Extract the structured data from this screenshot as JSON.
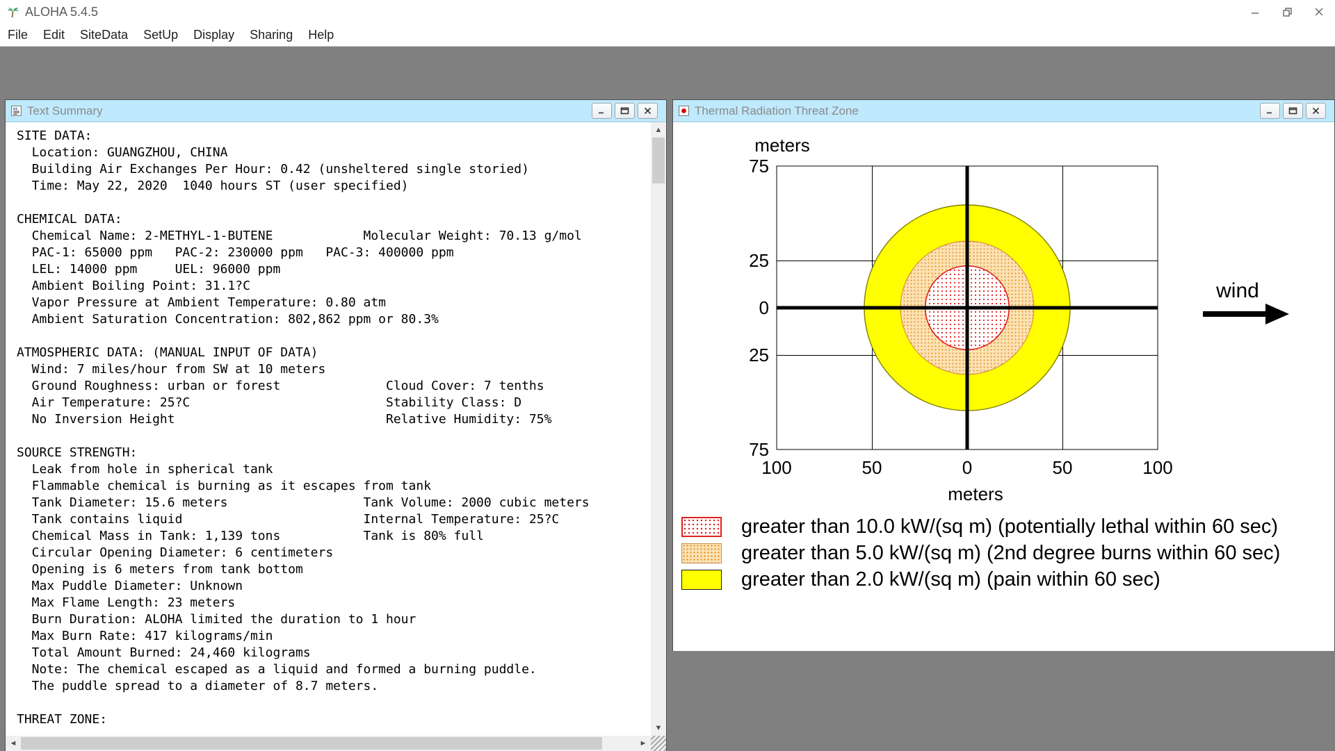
{
  "app": {
    "title": "ALOHA 5.4.5"
  },
  "menu": {
    "items": [
      "File",
      "Edit",
      "SiteData",
      "SetUp",
      "Display",
      "Sharing",
      "Help"
    ]
  },
  "icons": {
    "scroll_up": "▲",
    "scroll_down": "▼",
    "scroll_left": "◄",
    "scroll_right": "►"
  },
  "colors": {
    "mdi_background": "#808080",
    "child_titlebar": "#bfe9fc",
    "zone_red": "#e02020",
    "zone_orange": "#e8952e",
    "zone_yellow": "#ffff00"
  },
  "windows": {
    "text_summary": {
      "title": "Text Summary",
      "lines": [
        "SITE DATA:",
        "  Location: GUANGZHOU, CHINA",
        "  Building Air Exchanges Per Hour: 0.42 (unsheltered single storied)",
        "  Time: May 22, 2020  1040 hours ST (user specified)",
        "",
        "CHEMICAL DATA:",
        "  Chemical Name: 2-METHYL-1-BUTENE            Molecular Weight: 70.13 g/mol",
        "  PAC-1: 65000 ppm   PAC-2: 230000 ppm   PAC-3: 400000 ppm",
        "  LEL: 14000 ppm     UEL: 96000 ppm",
        "  Ambient Boiling Point: 31.1?C",
        "  Vapor Pressure at Ambient Temperature: 0.80 atm",
        "  Ambient Saturation Concentration: 802,862 ppm or 80.3%",
        "",
        "ATMOSPHERIC DATA: (MANUAL INPUT OF DATA)",
        "  Wind: 7 miles/hour from SW at 10 meters",
        "  Ground Roughness: urban or forest              Cloud Cover: 7 tenths",
        "  Air Temperature: 25?C                          Stability Class: D",
        "  No Inversion Height                            Relative Humidity: 75%",
        "",
        "SOURCE STRENGTH:",
        "  Leak from hole in spherical tank",
        "  Flammable chemical is burning as it escapes from tank",
        "  Tank Diameter: 15.6 meters                  Tank Volume: 2000 cubic meters",
        "  Tank contains liquid                        Internal Temperature: 25?C",
        "  Chemical Mass in Tank: 1,139 tons           Tank is 80% full",
        "  Circular Opening Diameter: 6 centimeters",
        "  Opening is 6 meters from tank bottom",
        "  Max Puddle Diameter: Unknown",
        "  Max Flame Length: 23 meters",
        "  Burn Duration: ALOHA limited the duration to 1 hour",
        "  Max Burn Rate: 417 kilograms/min",
        "  Total Amount Burned: 24,460 kilograms",
        "  Note: The chemical escaped as a liquid and formed a burning puddle.",
        "  The puddle spread to a diameter of 8.7 meters.",
        "",
        "THREAT ZONE:"
      ]
    },
    "threat_zone": {
      "title": "Thermal Radiation Threat Zone"
    }
  },
  "chart_data": {
    "type": "area",
    "title": "Thermal Radiation Threat Zone",
    "x_axis": {
      "label": "meters",
      "ticks": [
        "100",
        "50",
        "0",
        "50",
        "100"
      ],
      "range_m": [
        -100,
        100
      ],
      "grid": true
    },
    "y_axis": {
      "label": "meters",
      "ticks": [
        "75",
        "25",
        "0",
        "25",
        "75"
      ],
      "range_m": [
        -75,
        75
      ],
      "grid": true
    },
    "wind_label": "wind",
    "origin_crosshair": true,
    "zones": [
      {
        "name": "lethal",
        "threshold_kw_sqm": 10.0,
        "radius_m": 22,
        "color": "#e02020",
        "fill": "red-dot-pattern"
      },
      {
        "name": "second-degree-burns",
        "threshold_kw_sqm": 5.0,
        "radius_m": 35,
        "color": "#e8952e",
        "fill": "orange-stipple-pattern"
      },
      {
        "name": "pain",
        "threshold_kw_sqm": 2.0,
        "radius_m": 54,
        "color": "#ffff00",
        "fill": "solid-yellow"
      }
    ],
    "legend": [
      {
        "label": "greater than 10.0 kW/(sq m) (potentially lethal within 60 sec)"
      },
      {
        "label": "greater than 5.0 kW/(sq m) (2nd degree burns within 60 sec)"
      },
      {
        "label": "greater than 2.0 kW/(sq m) (pain within 60 sec)"
      }
    ]
  }
}
